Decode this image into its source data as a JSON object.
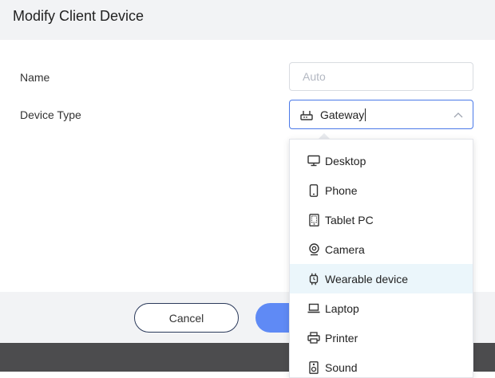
{
  "header": {
    "title": "Modify Client Device"
  },
  "form": {
    "name_label": "Name",
    "name_placeholder": "Auto",
    "device_type_label": "Device Type",
    "selected_device_type": "Gateway",
    "selected_icon": "gateway-icon"
  },
  "footer": {
    "cancel_label": "Cancel"
  },
  "dropdown": {
    "items": [
      {
        "label": "Desktop",
        "icon": "desktop-icon"
      },
      {
        "label": "Phone",
        "icon": "phone-icon"
      },
      {
        "label": "Tablet PC",
        "icon": "tablet-icon"
      },
      {
        "label": "Camera",
        "icon": "camera-icon"
      },
      {
        "label": "Wearable device",
        "icon": "watch-icon",
        "hovered": true
      },
      {
        "label": "Laptop",
        "icon": "laptop-icon"
      },
      {
        "label": "Printer",
        "icon": "printer-icon"
      },
      {
        "label": "Sound",
        "icon": "speaker-icon"
      }
    ]
  },
  "colors": {
    "accent": "#4a79e8",
    "primary_button": "#5f8af5",
    "hover_row": "#ebf6fb",
    "header_bg": "#f2f3f5"
  }
}
